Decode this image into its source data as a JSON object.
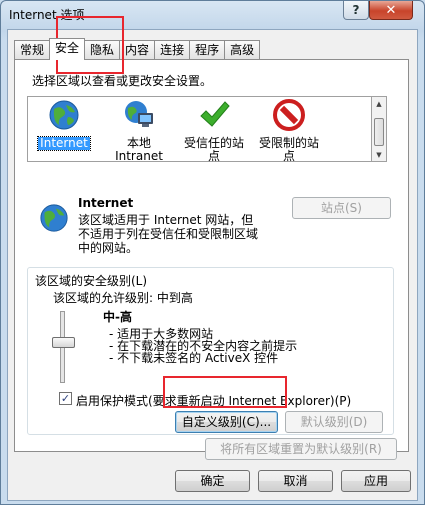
{
  "window": {
    "title": "Internet 选项",
    "help_glyph": "?",
    "close_glyph": "✕"
  },
  "tabs": [
    {
      "label": "常规"
    },
    {
      "label": "安全"
    },
    {
      "label": "隐私"
    },
    {
      "label": "内容"
    },
    {
      "label": "连接"
    },
    {
      "label": "程序"
    },
    {
      "label": "高级"
    }
  ],
  "security": {
    "instruction": "选择区域以查看或更改安全设置。",
    "zones": [
      {
        "label": "Internet",
        "icon": "globe-icon",
        "selected": true
      },
      {
        "label": "本地\nIntranet",
        "icon": "intranet-icon",
        "selected": false
      },
      {
        "label": "受信任的站\n点",
        "icon": "checkmark-icon",
        "selected": false
      },
      {
        "label": "受限制的站\n点",
        "icon": "prohibited-icon",
        "selected": false
      }
    ],
    "zone_title": "Internet",
    "zone_description": "该区域适用于 Internet 网站，但\n不适用于列在受信任和受限制区域\n中的网站。",
    "sites_button": "站点(S)",
    "level_group_title": "该区域的安全级别(L)",
    "allowed_levels": "该区域的允许级别: 中到高",
    "level_name": "中-高",
    "level_bullets": [
      "- 适用于大多数网站",
      "- 在下载潜在的不安全内容之前提示",
      "- 不下载未签名的 ActiveX 控件"
    ],
    "protected_mode_label": "启用保护模式(要求重新启动 Internet Explorer)(P)",
    "protected_mode_checked": true,
    "custom_level_button": "自定义级别(C)...",
    "default_level_button": "默认级别(D)",
    "reset_all_button": "将所有区域重置为默认级别(R)"
  },
  "footer": {
    "ok_button": "确定",
    "cancel_button": "取消",
    "apply_button": "应用"
  },
  "colors": {
    "highlight_box": "#e8262e",
    "selected_zone": "#3399ff"
  }
}
